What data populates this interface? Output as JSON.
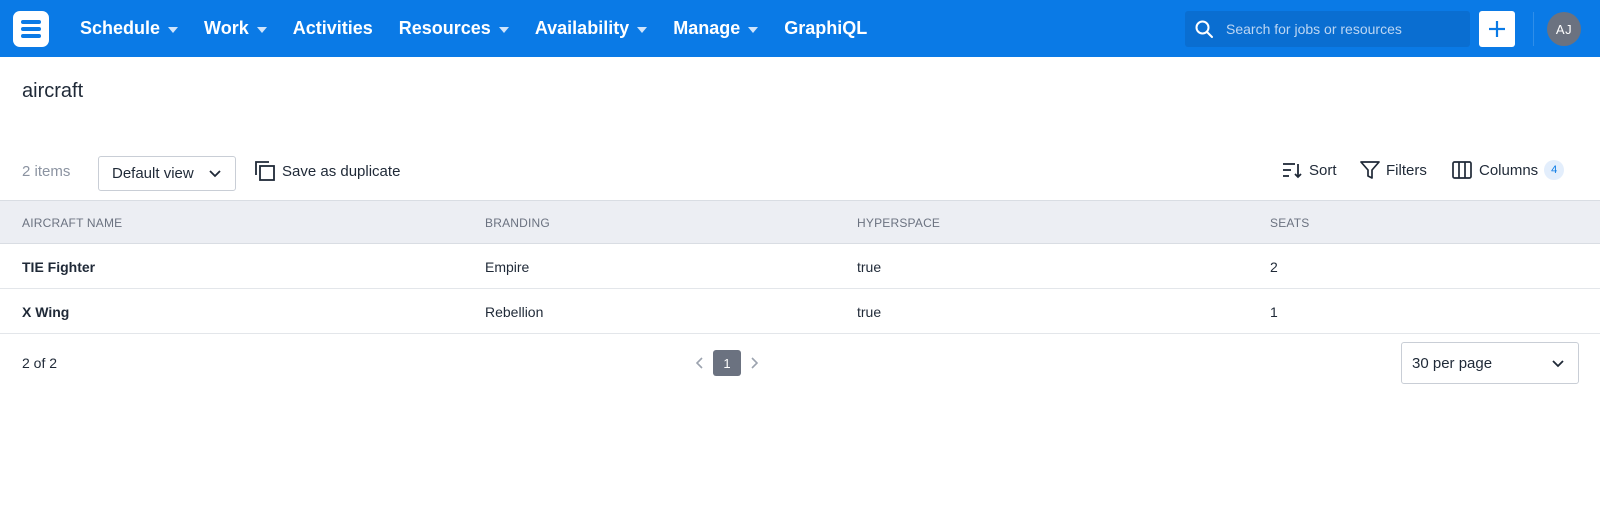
{
  "nav": {
    "items": [
      {
        "label": "Schedule",
        "has_caret": true
      },
      {
        "label": "Work",
        "has_caret": true
      },
      {
        "label": "Activities",
        "has_caret": false
      },
      {
        "label": "Resources",
        "has_caret": true
      },
      {
        "label": "Availability",
        "has_caret": true
      },
      {
        "label": "Manage",
        "has_caret": true
      },
      {
        "label": "GraphiQL",
        "has_caret": false
      }
    ],
    "search_placeholder": "Search for jobs or resources",
    "avatar_initials": "AJ",
    "brand_color": "#0a7ae6"
  },
  "page": {
    "title": "aircraft"
  },
  "toolbar": {
    "item_count": "2 items",
    "view_select": "Default view",
    "save_duplicate": "Save as duplicate",
    "sort": "Sort",
    "filters": "Filters",
    "columns": "Columns",
    "columns_count": "4"
  },
  "table": {
    "headers": [
      "AIRCRAFT NAME",
      "BRANDING",
      "HYPERSPACE",
      "SEATS"
    ],
    "rows": [
      [
        "TIE Fighter",
        "Empire",
        "true",
        "2"
      ],
      [
        "X Wing",
        "Rebellion",
        "true",
        "1"
      ]
    ]
  },
  "footer": {
    "range": "2 of 2",
    "current_page": "1",
    "per_page": "30 per page"
  }
}
